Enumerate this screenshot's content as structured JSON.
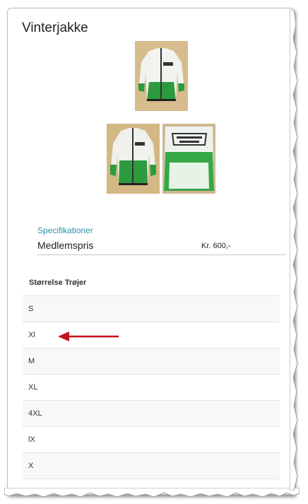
{
  "product": {
    "title": "Vinterjakke",
    "images": [
      "jacket-front-photo",
      "jacket-front-photo-2",
      "jacket-back-photo"
    ]
  },
  "specs": {
    "heading": "Specifikationer",
    "member_label": "Medlemspris",
    "member_price": "Kr. 600,-"
  },
  "sizes": {
    "heading": "Størrelse Trøjer",
    "rows": [
      "S",
      "Xl",
      "M",
      "XL",
      "4XL",
      "lX",
      "X"
    ]
  },
  "colors": {
    "accent": "#2f8fa6",
    "arrow": "#c0141a",
    "jacket_green": "#2e9a3e"
  }
}
